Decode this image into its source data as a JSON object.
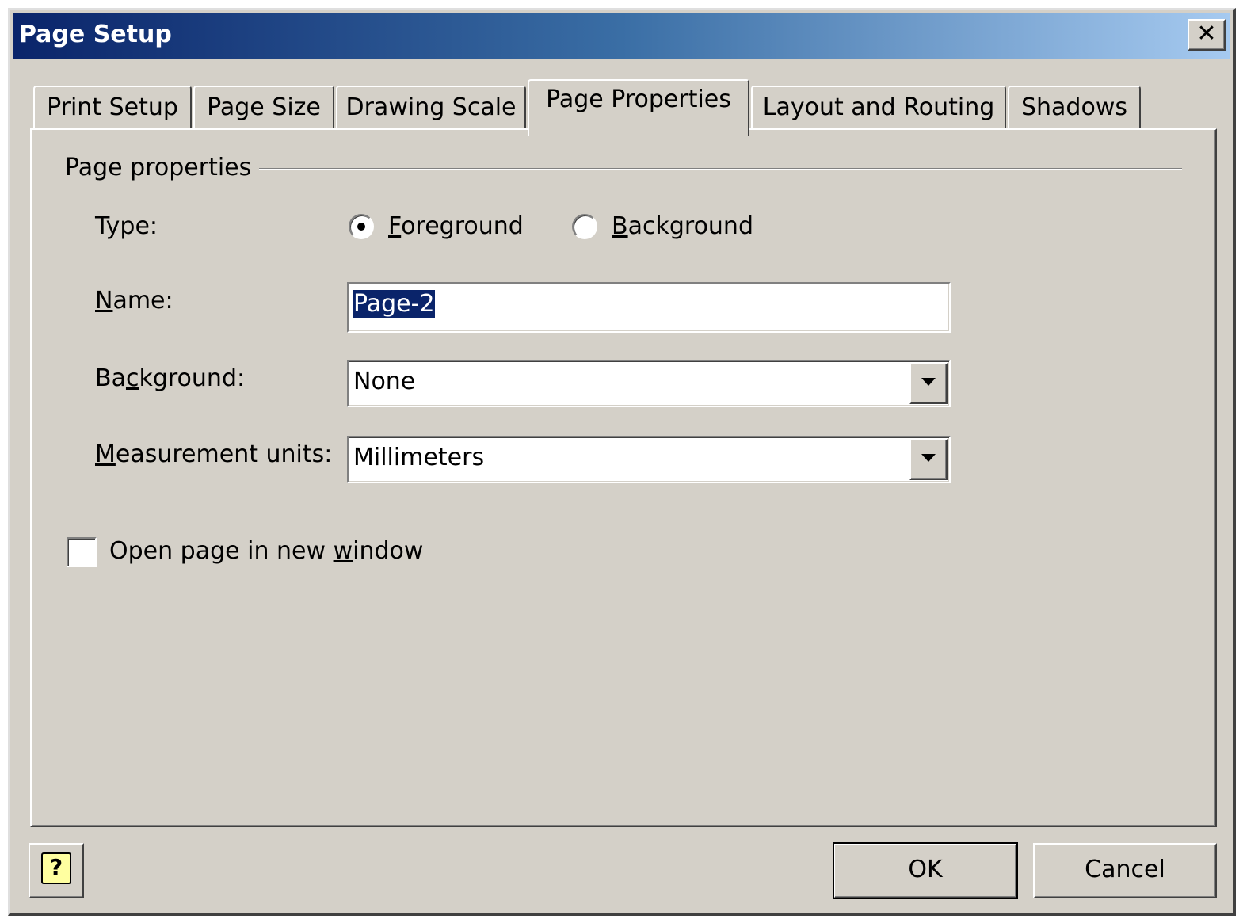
{
  "window": {
    "title": "Page Setup",
    "close_glyph": "✕"
  },
  "tabs": [
    {
      "label": "Print Setup",
      "active": false
    },
    {
      "label": "Page Size",
      "active": false
    },
    {
      "label": "Drawing Scale",
      "active": false
    },
    {
      "label": "Page Properties",
      "active": true
    },
    {
      "label": "Layout and Routing",
      "active": false
    },
    {
      "label": "Shadows",
      "active": false
    }
  ],
  "page_properties": {
    "group_label": "Page properties",
    "type": {
      "label": "Type:",
      "options": [
        {
          "label_mnemonic": "F",
          "label_rest": "oreground",
          "selected": true
        },
        {
          "label_mnemonic": "B",
          "label_rest": "ackground",
          "selected": false
        }
      ]
    },
    "name": {
      "label_pre": "",
      "label_mnemonic": "N",
      "label_post": "ame:",
      "value": "Page-2"
    },
    "background": {
      "label_pre": "Ba",
      "label_mnemonic": "c",
      "label_post": "kground:",
      "value": "None"
    },
    "measurement_units": {
      "label_pre": "",
      "label_mnemonic": "M",
      "label_post": "easurement units:",
      "value": "Millimeters"
    },
    "open_new_window": {
      "label_pre": "Open page in new ",
      "label_mnemonic": "w",
      "label_post": "indow",
      "checked": false
    }
  },
  "footer": {
    "help_icon": "help-icon",
    "help_glyph": "?",
    "ok_label": "OK",
    "cancel_label": "Cancel"
  },
  "colors": {
    "face": "#d4d0c8",
    "title_start": "#0a246a",
    "title_end": "#a6caf0",
    "selection": "#0a246a"
  }
}
